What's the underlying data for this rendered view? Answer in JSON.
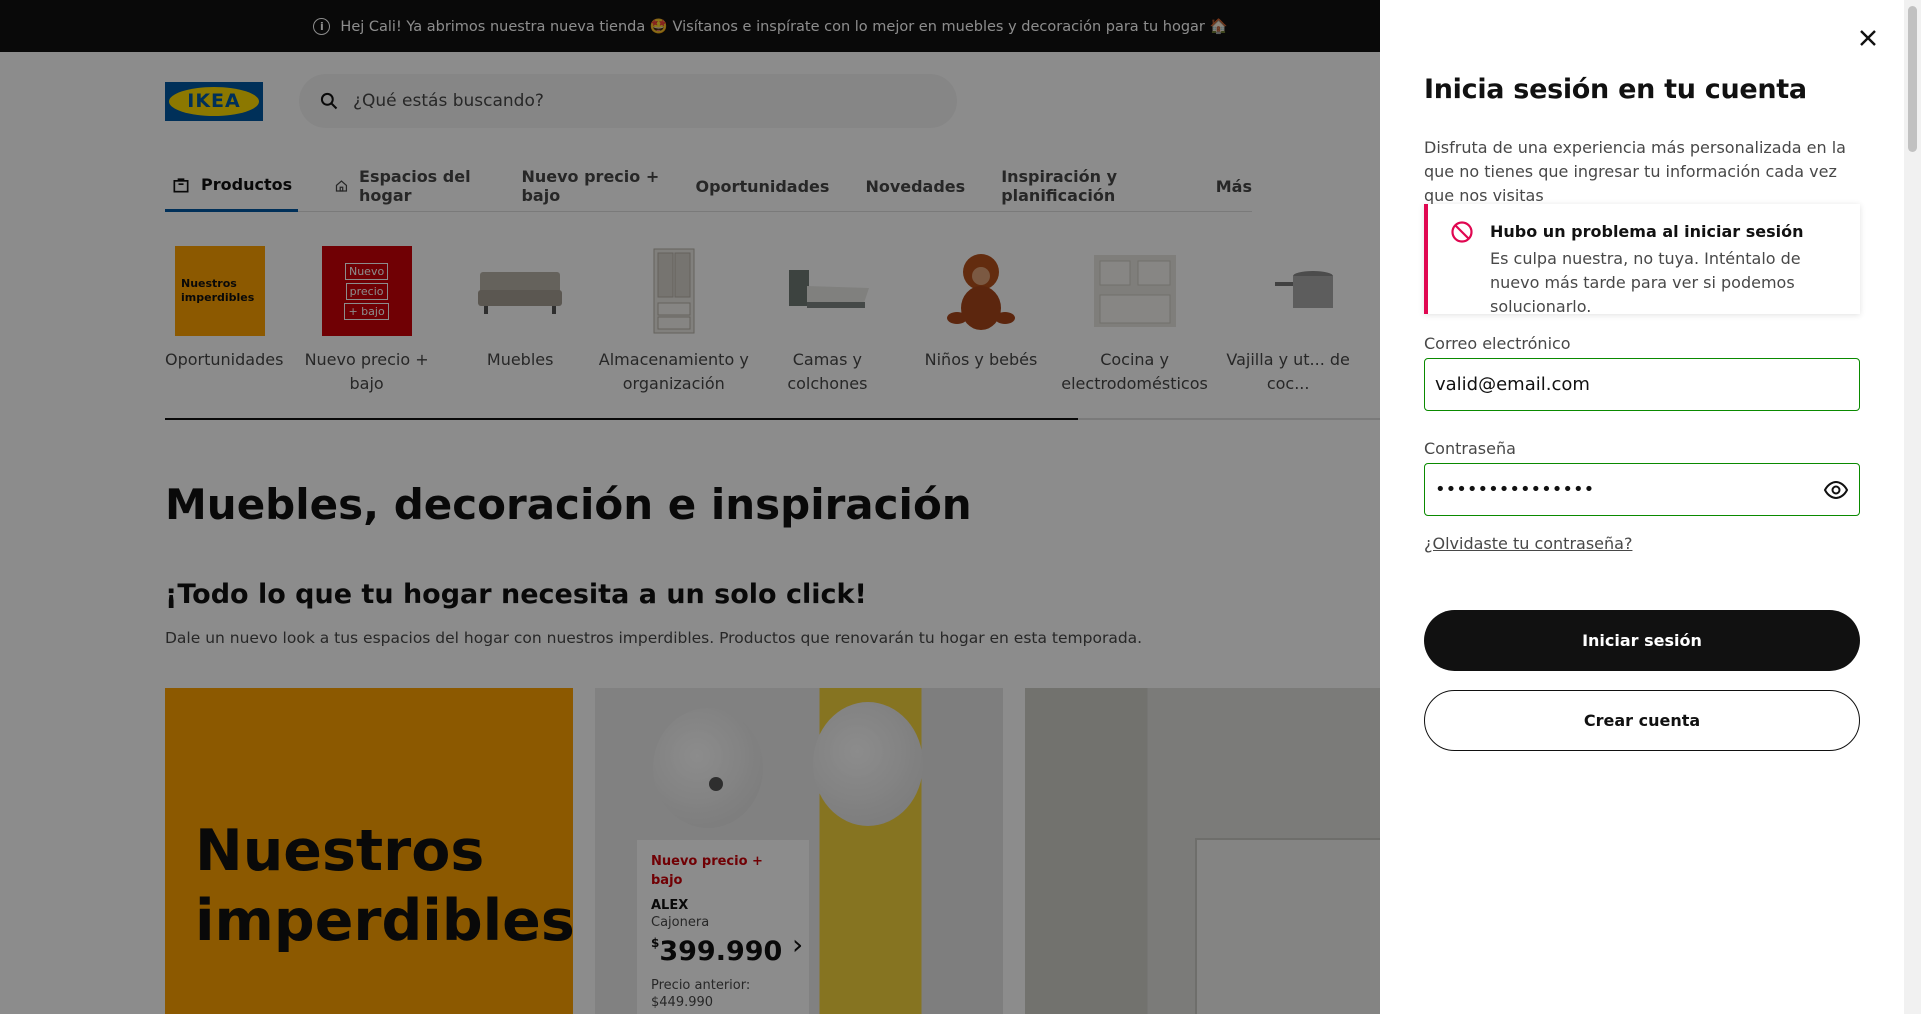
{
  "announcement": "Hej Cali! Ya abrimos nuestra nueva tienda 🤩 Visítanos e inspírate con lo mejor en muebles y decoración para tu hogar 🏠",
  "brand": "IKEA",
  "search": {
    "placeholder": "¿Qué estás buscando?"
  },
  "nav": [
    "Productos",
    "Espacios del hogar",
    "Nuevo precio + bajo",
    "Oportunidades",
    "Novedades",
    "Inspiración y planificación",
    "Más"
  ],
  "categories": [
    "Oportunidades",
    "Nuevo precio + bajo",
    "Muebles",
    "Almacenamiento y organización",
    "Camas y colchones",
    "Niños y bebés",
    "Cocina y electrodomésticos",
    "Vajilla y ut... de coc..."
  ],
  "thumb_yellow": "Nuestros imperdibles",
  "thumb_red": [
    "Nuevo",
    "precio",
    "+ bajo"
  ],
  "carousel_progress": 0.73,
  "page_title": "Muebles, decoración e inspiración",
  "section_title": "¡Todo lo que tu hogar necesita a un solo click!",
  "section_text": "Dale un nuevo look a tus espacios del hogar con nuestros imperdibles. Productos que renovarán tu hogar en esta temporada.",
  "promo_card": "Nuestros imperdibles",
  "product": {
    "tag": "Nuevo precio + bajo",
    "name": "ALEX",
    "desc": "Cajonera",
    "currency": "$",
    "price": "399.990",
    "prev_label": "Precio anterior:",
    "prev_price": "$449.990"
  },
  "modal": {
    "title": "Inicia sesión en tu cuenta",
    "description": "Disfruta de una experiencia más personalizada en la que no tienes que ingresar tu información cada vez que nos visitas",
    "error_title": "Hubo un problema al iniciar sesión",
    "error_text": "Es culpa nuestra, no tuya. Inténtalo de nuevo más tarde para ver si podemos solucionarlo.",
    "email_label": "Correo electrónico",
    "email_value": "valid@email.com",
    "password_label": "Contraseña",
    "password_value": "•••••••••••••••",
    "forgot": "¿Olvidaste tu contraseña?",
    "login_button": "Iniciar sesión",
    "create_button": "Crear cuenta"
  },
  "colors": {
    "accent_blue": "#0058a3",
    "ikea_yellow": "#ffdb00",
    "error": "#e00751",
    "valid_green": "#0a8a00"
  }
}
